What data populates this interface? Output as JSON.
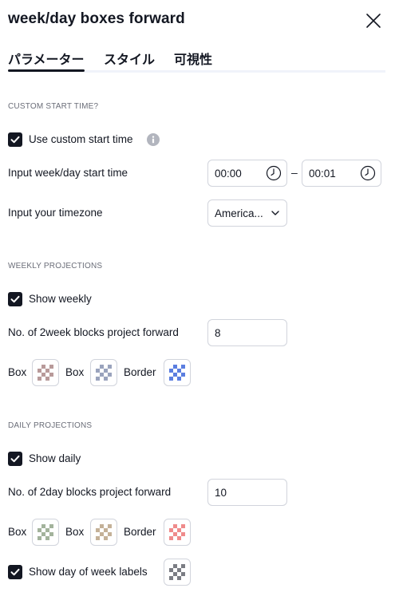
{
  "dialog": {
    "title": "week/day boxes forward",
    "tabs": [
      {
        "label": "パラメーター",
        "active": true
      },
      {
        "label": "スタイル",
        "active": false
      },
      {
        "label": "可視性",
        "active": false
      }
    ]
  },
  "custom_start": {
    "section_title": "CUSTOM START TIME?",
    "use_custom_label": "Use custom start time",
    "use_custom_checked": true,
    "start_time_label": "Input week/day start time",
    "start_time_from": "00:00",
    "start_time_to": "00:01",
    "timezone_label": "Input your timezone",
    "timezone_value": "America..."
  },
  "weekly": {
    "section_title": "WEEKLY PROJECTIONS",
    "show_label": "Show weekly",
    "show_checked": true,
    "blocks_label": "No. of 2week blocks project forward",
    "blocks_value": "8",
    "box1_label": "Box",
    "box2_label": "Box",
    "border_label": "Border",
    "colors": {
      "box1": "#b89a9a",
      "box2": "#9aa3bd",
      "border": "#5b7ee0"
    }
  },
  "daily": {
    "section_title": "DAILY PROJECTIONS",
    "show_label": "Show daily",
    "show_checked": true,
    "blocks_label": "No. of 2day blocks project forward",
    "blocks_value": "10",
    "box1_label": "Box",
    "box2_label": "Box",
    "border_label": "Border",
    "colors": {
      "box1": "#a3b39c",
      "box2": "#c4b198",
      "border": "#ef8b8b"
    },
    "day_labels_label": "Show day of week labels",
    "day_labels_checked": true,
    "day_labels_color": "#7b7d84"
  },
  "icons": {
    "close": "close-icon",
    "info": "info-icon",
    "clock": "clock-icon",
    "chevron": "chevron-down-icon",
    "check": "checkmark-icon"
  },
  "theme": {
    "accent": "#131722",
    "border": "#d1d4dc",
    "muted": "#6a6d78"
  }
}
